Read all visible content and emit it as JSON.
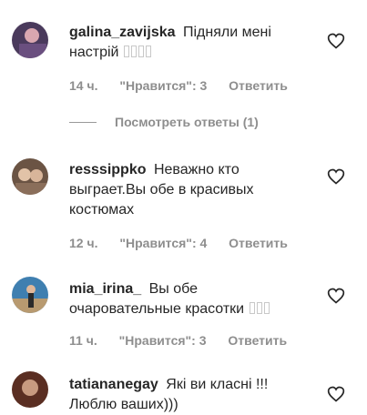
{
  "comments": [
    {
      "username": "galina_zavijska",
      "text": "Підняли мені настрій",
      "emoji_count": 4,
      "time": "14 ч.",
      "likes": "\"Нравится\": 3",
      "reply": "Ответить",
      "view_replies": "Посмотреть ответы (1)",
      "avatar_colors": [
        "#4a3a5c",
        "#d9a7b0"
      ]
    },
    {
      "username": "resssippko",
      "text": "Неважно кто выграет.Вы обе в красивых костюмах",
      "emoji_count": 0,
      "time": "12 ч.",
      "likes": "\"Нравится\": 4",
      "reply": "Ответить",
      "avatar_colors": [
        "#6b5444",
        "#e2c3a8"
      ]
    },
    {
      "username": "mia_irina_",
      "text": "Вы обе очаровательные красотки",
      "emoji_count": 3,
      "time": "11 ч.",
      "likes": "\"Нравится\": 3",
      "reply": "Ответить",
      "avatar_colors": [
        "#3f7fb0",
        "#b89a70"
      ]
    },
    {
      "username": "tatiananegay",
      "text": "Які ви класні !!!",
      "second_line": "Люблю ваших)))",
      "avatar_colors": [
        "#5a2e22",
        "#c79a80"
      ]
    }
  ]
}
